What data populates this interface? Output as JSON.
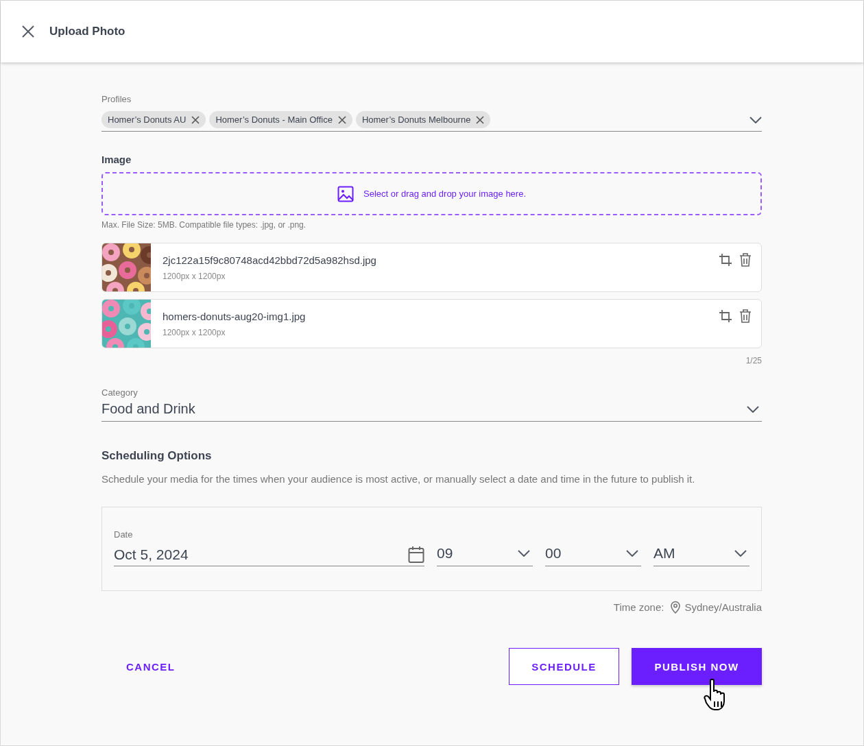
{
  "window": {
    "title": "Upload Photo"
  },
  "profiles": {
    "label": "Profiles",
    "chips": [
      "Homer’s Donuts AU",
      "Homer’s Donuts - Main Office",
      "Homer’s Donuts Melbourne"
    ]
  },
  "image": {
    "label": "Image",
    "dropzone": "Select or drag and drop your image here.",
    "hint": "Max. File Size: 5MB. Compatible file types: .jpg, or .png.",
    "files": [
      {
        "name": "2jc122a15f9c80748acd42bbd72d5a982hsd.jpg",
        "size": "1200px x 1200px",
        "kind": "picture"
      },
      {
        "name": "homers-donuts-aug20-img1.jpg",
        "size": "1200px x 1200px",
        "kind": "picture"
      }
    ],
    "counter": "1/25"
  },
  "category": {
    "label": "Category",
    "value": "Food and Drink"
  },
  "scheduling": {
    "title": "Scheduling Options",
    "description": "Schedule your media for the times when your audience is most active, or manually select a date and time in the future to publish it.",
    "date": {
      "label": "Date",
      "value": "Oct 5, 2024"
    },
    "hour": "09",
    "minute": "00",
    "period": "AM",
    "timezone_label": "Time zone:",
    "timezone": "Sydney/Australia"
  },
  "buttons": [
    {
      "label": "CANCEL",
      "kind": "text"
    },
    {
      "label": "SCHEDULE",
      "kind": "outlined"
    },
    {
      "label": "PUBLISH NOW",
      "kind": "filled"
    }
  ]
}
